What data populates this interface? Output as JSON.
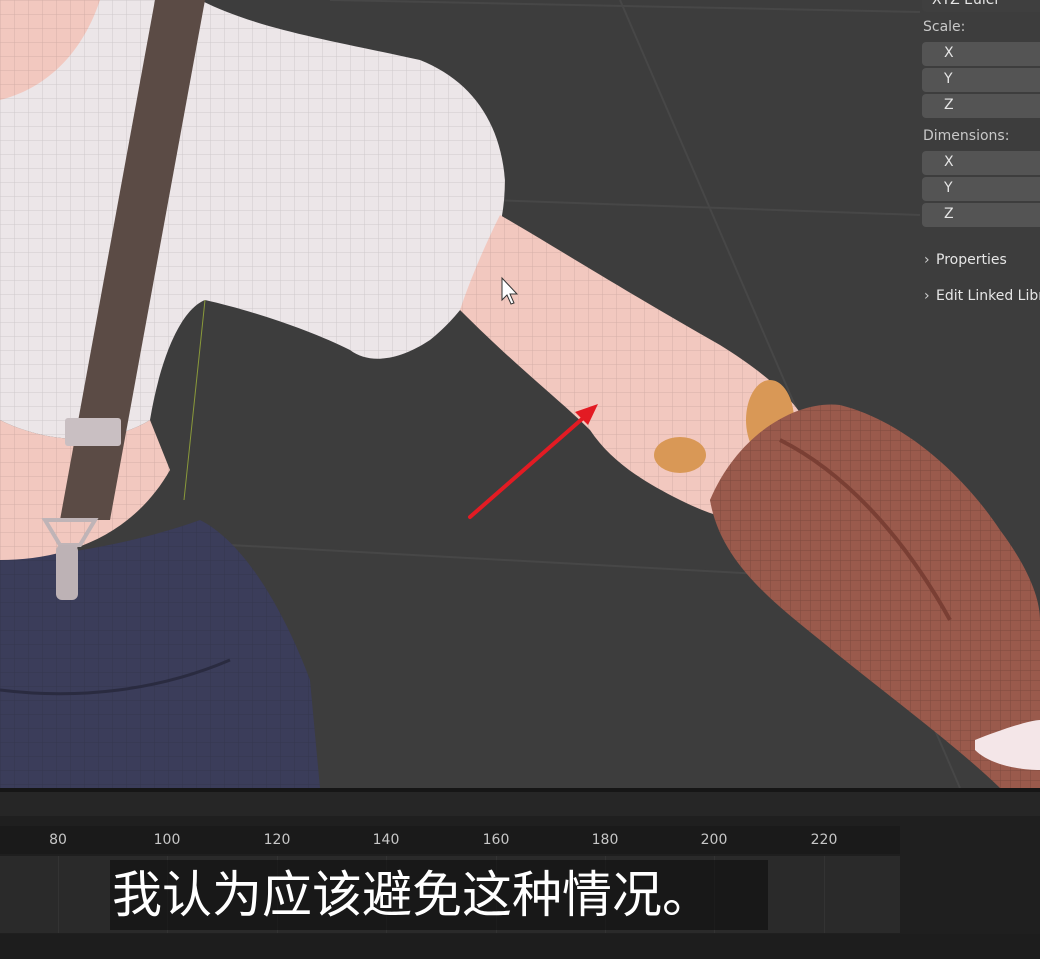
{
  "n_panel": {
    "rotation_mode": "XYZ Euler",
    "scale_label": "Scale:",
    "scale_axes": [
      "X",
      "Y",
      "Z"
    ],
    "dimensions_label": "Dimensions:",
    "dimensions_axes": [
      "X",
      "Y",
      "Z"
    ],
    "properties_label": "Properties",
    "edit_linked_label": "Edit Linked Libr"
  },
  "timeline": {
    "frames": [
      "80",
      "100",
      "120",
      "140",
      "160",
      "180",
      "200",
      "220"
    ]
  },
  "subtitle": "我认为应该避免这种情况。",
  "colors": {
    "viewport_bg": "#3d3d3d",
    "arrow": "#e31b23",
    "skin": "#f2c8bf",
    "shirt": "#ece6e8",
    "sleeve_brown": "#9a5a4c",
    "pants": "#3b3d5a",
    "suspender": "#5b4b45"
  }
}
